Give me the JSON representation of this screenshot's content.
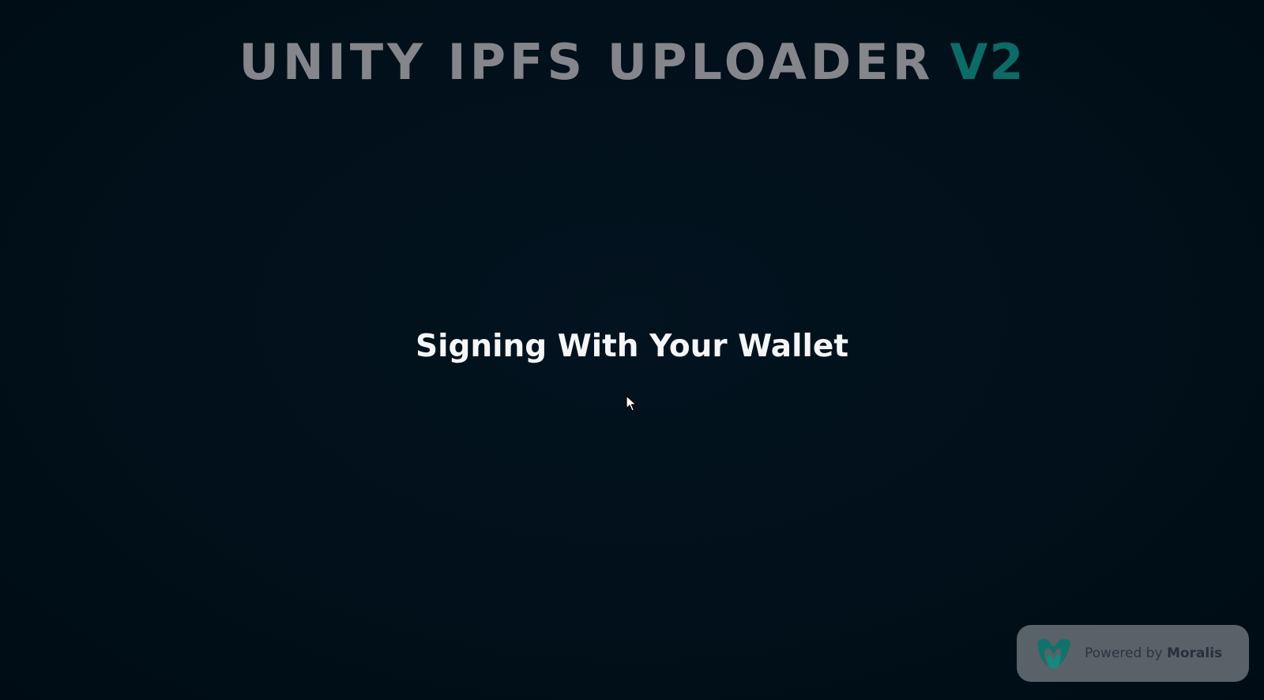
{
  "header": {
    "title_main": "UNITY IPFS UPLOADER",
    "title_version": "V2"
  },
  "main": {
    "status": "Signing With Your Wallet"
  },
  "badge": {
    "prefix": "Powered by",
    "brand": "Moralis",
    "logo_icon": "moralis-logo-icon"
  },
  "colors": {
    "background": "#010f1a",
    "title_gray": "#84868b",
    "accent_teal": "#0b6b67",
    "status_text": "#f4f6f8",
    "badge_bg": "#596169",
    "badge_text": "#2b3440"
  },
  "cursor_icon": "mouse-pointer-icon"
}
